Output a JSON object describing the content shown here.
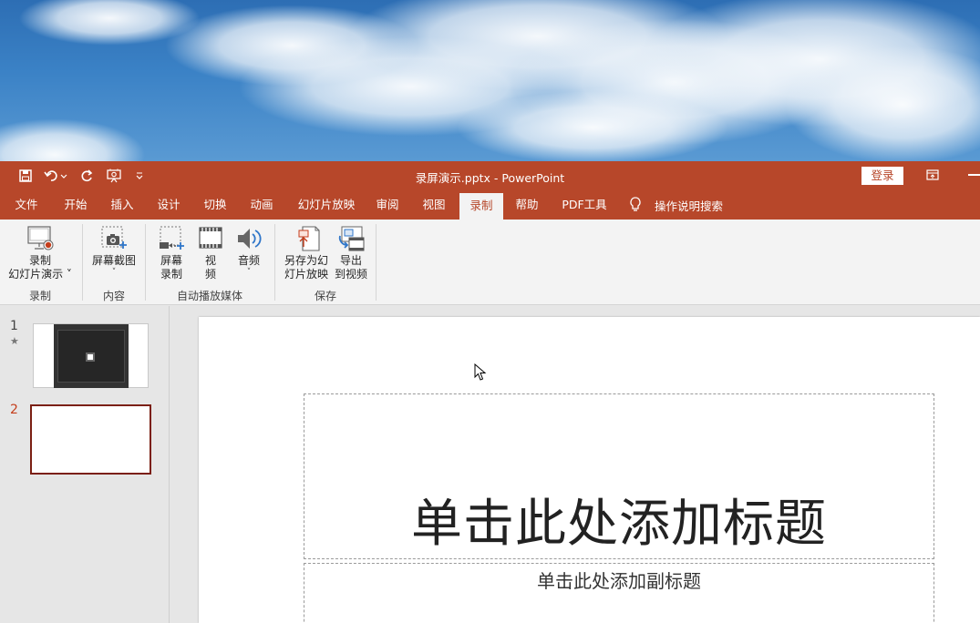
{
  "titlebar": {
    "doc_title": "录屏演示.pptx  -  PowerPoint",
    "signin_label": "登录",
    "colors": {
      "accent": "#b7472a"
    }
  },
  "quick_access": {
    "icons": [
      "save-icon",
      "undo-icon",
      "redo-icon",
      "slideshow-from-start-icon",
      "customize-dropdown-icon"
    ]
  },
  "tabs": [
    {
      "label": "文件"
    },
    {
      "label": "开始"
    },
    {
      "label": "插入"
    },
    {
      "label": "设计"
    },
    {
      "label": "切换"
    },
    {
      "label": "动画"
    },
    {
      "label": "幻灯片放映"
    },
    {
      "label": "审阅"
    },
    {
      "label": "视图"
    },
    {
      "label": "录制",
      "active": true
    },
    {
      "label": "帮助"
    },
    {
      "label": "PDF工具"
    }
  ],
  "search_tab": {
    "label": "操作说明搜索",
    "icon": "lightbulb-icon"
  },
  "ribbon": {
    "groups": [
      {
        "label": "录制",
        "buttons": [
          {
            "line1": "录制",
            "line2": "幻灯片演示 ˅",
            "icon": "record-slideshow-icon"
          }
        ]
      },
      {
        "label": "内容",
        "buttons": [
          {
            "line1": "屏幕截图",
            "line2": "˅",
            "icon": "screenshot-icon"
          }
        ]
      },
      {
        "label": "自动播放媒体",
        "buttons": [
          {
            "line1": "屏幕",
            "line2": "录制",
            "icon": "screen-recording-icon"
          },
          {
            "line1": "视",
            "line2": "频",
            "icon": "video-icon"
          },
          {
            "line1": "音频",
            "line2": "˅",
            "icon": "audio-icon"
          }
        ]
      },
      {
        "label": "保存",
        "buttons": [
          {
            "line1": "另存为幻",
            "line2": "灯片放映",
            "icon": "save-as-show-icon"
          },
          {
            "line1": "导出",
            "line2": "到视频",
            "icon": "export-video-icon"
          }
        ]
      }
    ]
  },
  "slides_panel": {
    "slides": [
      {
        "number": "1",
        "marker": "★"
      },
      {
        "number": "2",
        "selected": true
      }
    ]
  },
  "slide": {
    "title_placeholder": "单击此处添加标题",
    "subtitle_placeholder": "单击此处添加副标题"
  }
}
